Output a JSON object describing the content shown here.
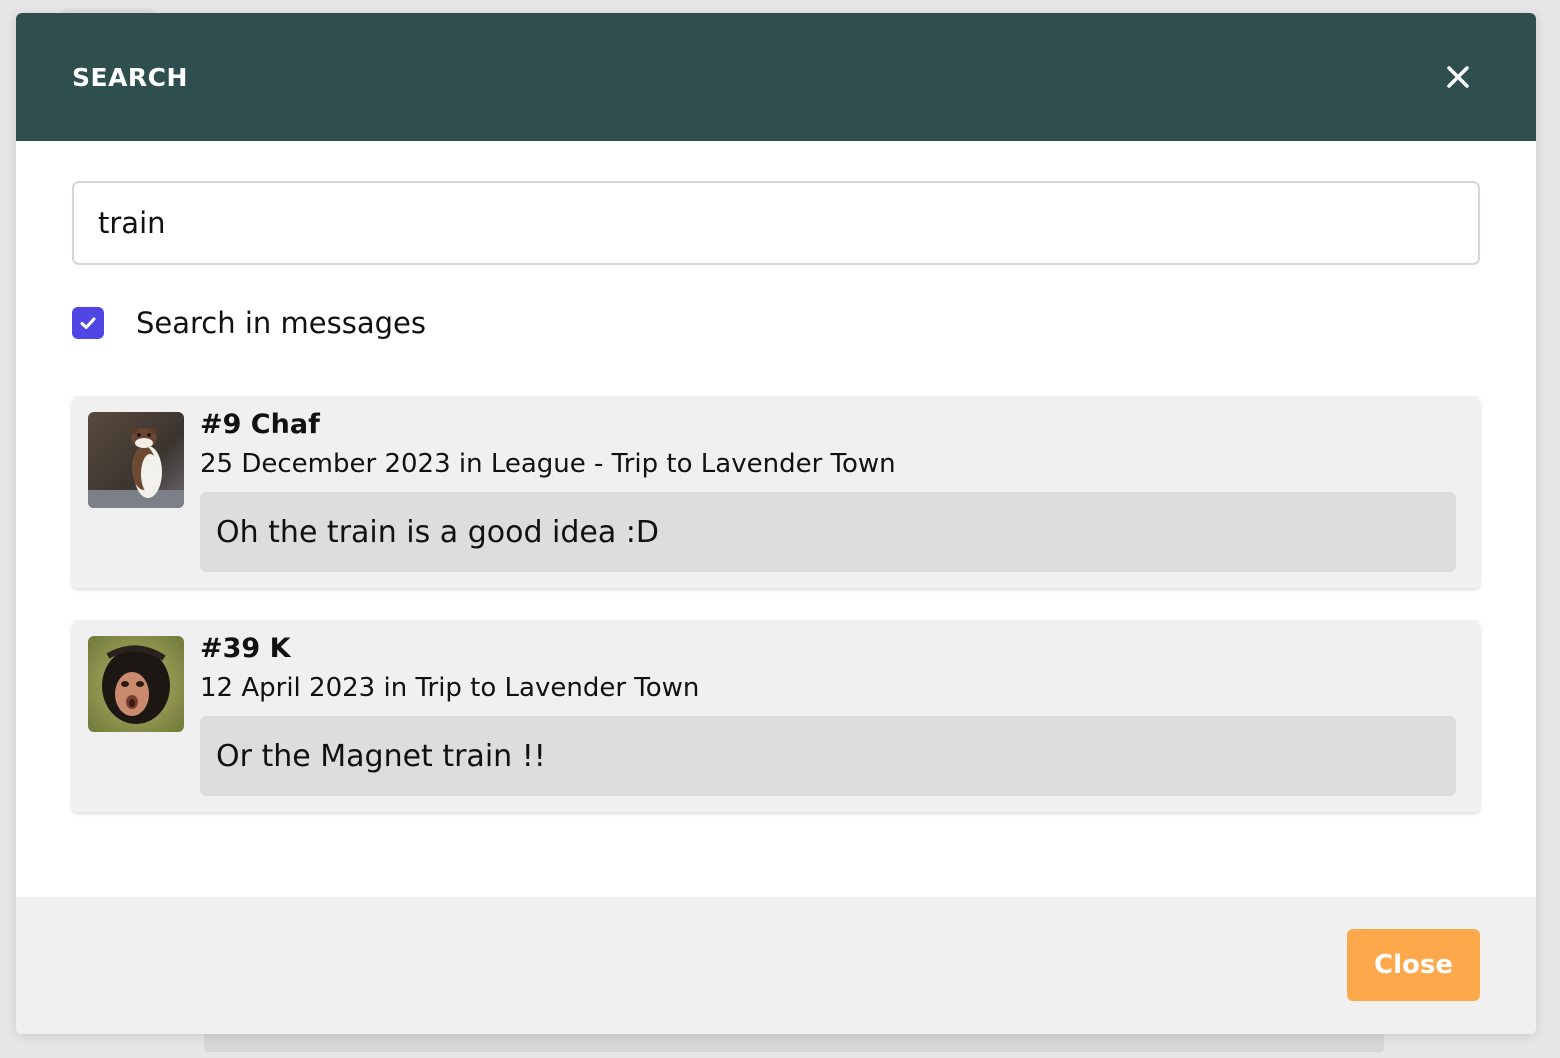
{
  "modal": {
    "title": "SEARCH",
    "close_icon": "close-icon"
  },
  "search": {
    "value": "train",
    "placeholder": ""
  },
  "options": {
    "search_in_messages": {
      "label": "Search in messages",
      "checked": true,
      "color": "#5046e5"
    }
  },
  "results": [
    {
      "title": "#9 Chaf",
      "meta": "25 December 2023 in League - Trip to Lavender Town",
      "message": "Oh the train is a good idea :D",
      "avatar": "weasel-avatar"
    },
    {
      "title": "#39 K",
      "meta": "12 April 2023 in Trip to Lavender Town",
      "message": "Or the Magnet train !!",
      "avatar": "monkey-avatar"
    }
  ],
  "footer": {
    "close_label": "Close",
    "close_color": "#fda94b"
  },
  "colors": {
    "header_bg": "#2f4f4f"
  }
}
